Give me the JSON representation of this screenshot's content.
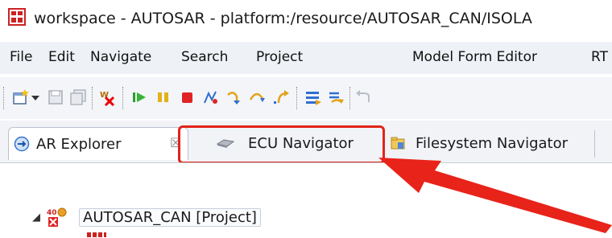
{
  "window": {
    "title": "workspace - AUTOSAR - platform:/resource/AUTOSAR_CAN/ISOLA"
  },
  "menu": {
    "items": [
      "File",
      "Edit",
      "Navigate",
      "Search",
      "Project",
      "Model Form Editor",
      "RT"
    ]
  },
  "toolbar": {
    "icons": [
      "new-wizard-icon",
      "dropdown-arrow-icon",
      "save-icon",
      "save-all-icon",
      "validate-icon",
      "play-icon",
      "pause-icon",
      "stop-icon",
      "disconnect-icon",
      "step-into-icon",
      "step-over-icon",
      "step-return-icon",
      "filter-icon",
      "connect-icon",
      "back-icon"
    ]
  },
  "tabs": {
    "ar_explorer": "AR Explorer",
    "ar_explorer_close": "☒",
    "ecu_navigator": "ECU Navigator",
    "filesystem_navigator": "Filesystem Navigator"
  },
  "tree": {
    "project_label": "AUTOSAR_CAN [Project]",
    "project_badge": "40",
    "toggle": "◢"
  },
  "colors": {
    "highlight": "#e2231a",
    "accent_blue": "#2f6fd1"
  }
}
